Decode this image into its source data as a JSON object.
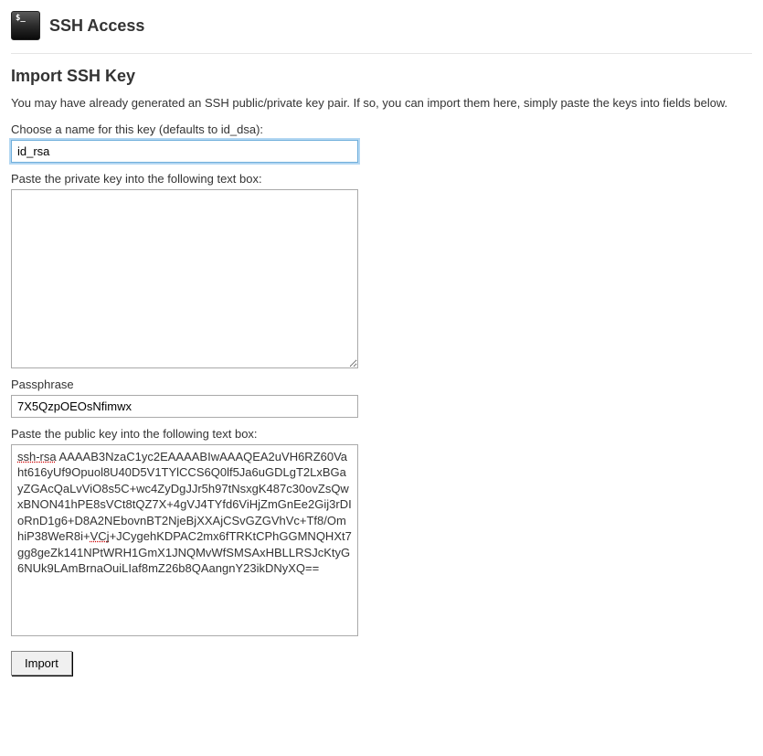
{
  "header": {
    "title": "SSH Access",
    "icon_prompt": "$_"
  },
  "section": {
    "title": "Import SSH Key",
    "intro": "You may have already generated an SSH public/private key pair. If so, you can import them here, simply paste the keys into fields below."
  },
  "fields": {
    "key_name": {
      "label": "Choose a name for this key (defaults to id_dsa):",
      "value": "id_rsa"
    },
    "private_key": {
      "label": "Paste the private key into the following text box:",
      "value": ""
    },
    "passphrase": {
      "label": "Passphrase",
      "value": "7X5QzpOEOsNfimwx"
    },
    "public_key": {
      "label": "Paste the public key into the following text box:",
      "value_prefix": "ssh-rsa",
      "value_body_1": " AAAAB3NzaC1yc2EAAAABIwAAAQEA2uVH6RZ60Vaht616yUf9Opuol8U40D5V1TYlCCS6Q0lf5Ja6uGDLgT2LxBGayZGAcQaLvViO8s5C+wc4ZyDgJJr5h97tNsxgK487c30ovZsQwxBNON41hPE8sVCt8tQZ7X+4gVJ4TYfd6ViHjZmGnEe2Gij3rDIoRnD1g6+D8A2NEbovnBT2NjeBjXXAjCSvGZGVhVc+Tf8/OmhiP38WeR8i+",
      "value_body_2_spelled": "VCj",
      "value_body_3": "+JCygehKDPAC2mx6fTRKtCPhGGMNQHXt7gg8geZk141NPtWRH1GmX1JNQMvWfSMSAxHBLLRSJcKtyG6NUk9LAmBrnaOuiLIaf8mZ26b8QAangnY23ikDNyXQ=="
    }
  },
  "buttons": {
    "import": "Import"
  }
}
